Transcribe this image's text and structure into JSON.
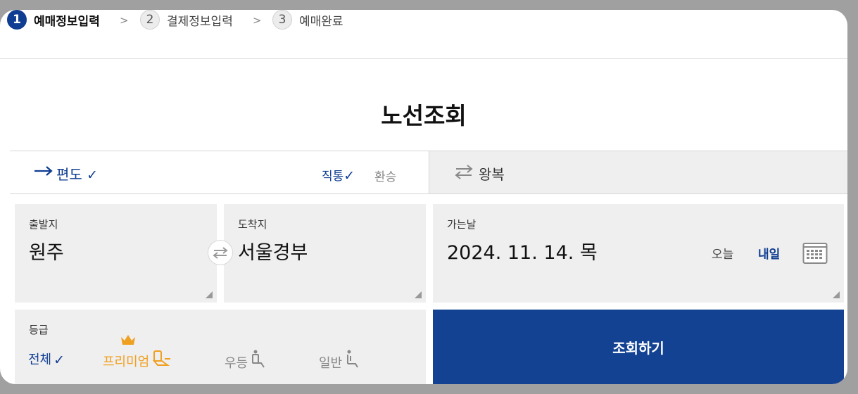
{
  "steps": [
    {
      "num": "1",
      "label": "예매정보입력"
    },
    {
      "num": "2",
      "label": "결제정보입력"
    },
    {
      "num": "3",
      "label": "예매완료"
    }
  ],
  "page_title": "노선조회",
  "trip": {
    "oneway_label": "편도",
    "direct_label": "직통",
    "transfer_label": "환승",
    "round_label": "왕복"
  },
  "departure": {
    "caption": "출발지",
    "value": "원주"
  },
  "arrival": {
    "caption": "도착지",
    "value": "서울경부"
  },
  "date": {
    "caption": "가는날",
    "value": "2024. 11. 14. 목",
    "today": "오늘",
    "tomorrow": "내일"
  },
  "grade": {
    "caption": "등급",
    "options": {
      "all": "전체",
      "premium": "프리미엄",
      "first": "우등",
      "economy": "일반"
    }
  },
  "search_button": "조회하기",
  "colors": {
    "accent": "#0f3d91",
    "button": "#134293",
    "premium": "#f0a020"
  },
  "icons": [
    "arrow-right-icon",
    "check-icon",
    "swap-icon",
    "calendar-icon",
    "crown-icon",
    "seat-icon",
    "chevron-right-icon",
    "resize-corner-icon"
  ]
}
